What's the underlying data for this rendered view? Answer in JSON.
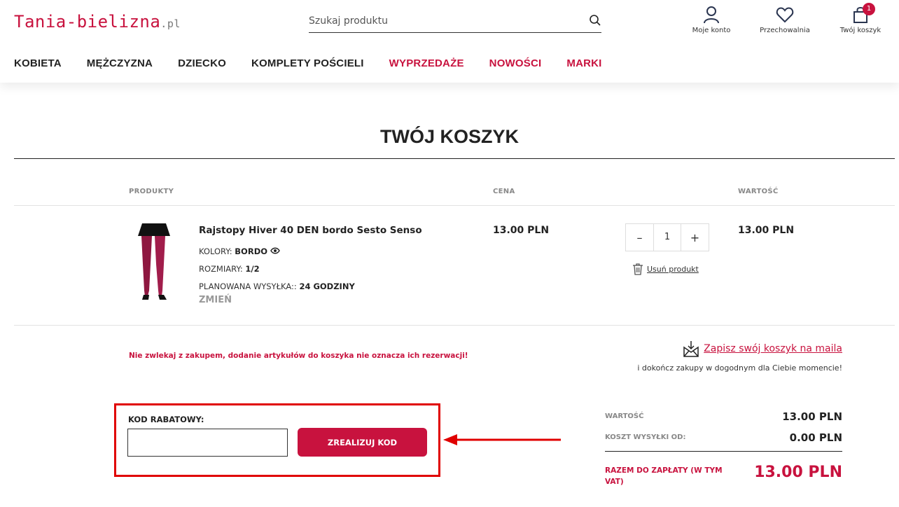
{
  "header": {
    "logo_main": "Tania-bielizna",
    "logo_tld": ".pl",
    "search_placeholder": "Szukaj produktu",
    "account_label": "Moje konto",
    "wishlist_label": "Przechowalnia",
    "cart_label": "Twój koszyk",
    "cart_count": "1"
  },
  "nav": [
    {
      "label": "KOBIETA",
      "highlight": false
    },
    {
      "label": "MĘŻCZYZNA",
      "highlight": false
    },
    {
      "label": "DZIECKO",
      "highlight": false
    },
    {
      "label": "KOMPLETY POŚCIELI",
      "highlight": false
    },
    {
      "label": "WYPRZEDAŻE",
      "highlight": true
    },
    {
      "label": "NOWOŚCI",
      "highlight": true
    },
    {
      "label": "MARKI",
      "highlight": true
    }
  ],
  "page_title": "TWÓJ KOSZYK",
  "table": {
    "col_products": "PRODUKTY",
    "col_price": "CENA",
    "col_value": "WARTOŚĆ"
  },
  "item": {
    "name": "Rajstopy Hiver 40 DEN bordo Sesto Senso",
    "color_label": "KOLORY:",
    "color_value": "BORDO",
    "size_label": "ROZMIARY:",
    "size_value": "1/2",
    "shipping_label": "PLANOWANA WYSYŁKA::",
    "shipping_value": "24 GODZINY",
    "change_label": "ZMIEŃ",
    "price": "13.00 PLN",
    "quantity": "1",
    "value": "13.00 PLN",
    "remove_label": "Usuń produkt"
  },
  "notice": "Nie zwlekaj z zakupem, dodanie artykułów do koszyka nie oznacza ich rezerwacji!",
  "save_cart": {
    "link": "Zapisz swój koszyk na maila",
    "sub": "i dokończ zakupy w dogodnym dla Ciebie momencie!"
  },
  "coupon": {
    "label": "KOD RABATOWY:",
    "value": "",
    "button": "ZREALIZUJ KOD"
  },
  "summary": {
    "value_label": "WARTOŚĆ",
    "value": "13.00 PLN",
    "shipping_label": "KOSZT WYSYŁKI OD:",
    "shipping": "0.00 PLN",
    "total_label": "RAZEM DO ZAPŁATY (W TYM VAT)",
    "total": "13.00 PLN"
  },
  "colors": {
    "brand": "#c8123e",
    "annotation": "#e00000"
  }
}
